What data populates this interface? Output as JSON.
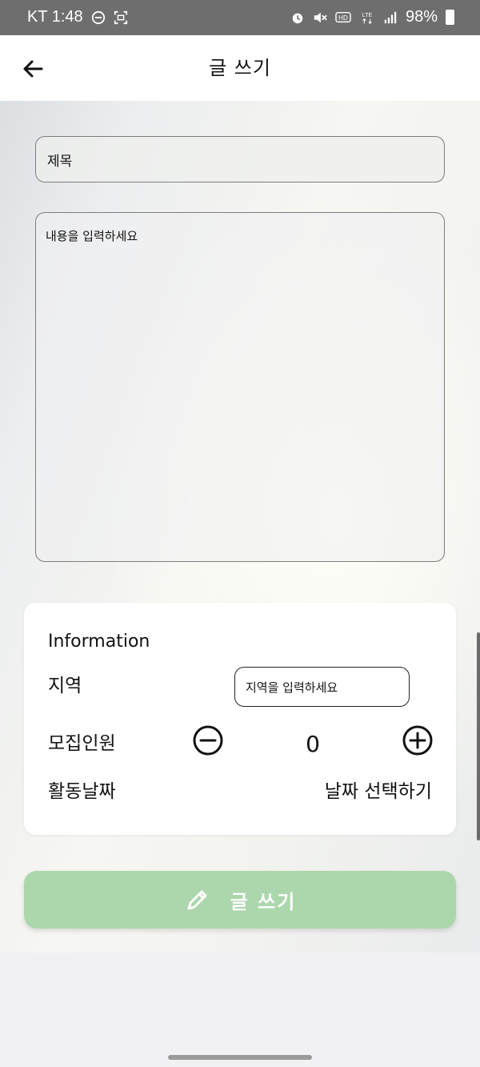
{
  "status_bar": {
    "carrier_time": "KT 1:48",
    "network": "LTE",
    "battery": "98%",
    "left_icons": [
      "minus-circle-icon",
      "screen-record-icon"
    ],
    "right_icons": [
      "alarm-icon",
      "mute-icon",
      "hd-icon",
      "lte-icon",
      "signal-icon",
      "battery-icon"
    ]
  },
  "app_bar": {
    "title": "글 쓰기",
    "back_icon": "arrow-left-icon"
  },
  "form": {
    "title_placeholder": "제목",
    "content_placeholder": "내용을 입력하세요"
  },
  "info": {
    "heading": "Information",
    "region_label": "지역",
    "region_placeholder": "지역을 입력하세요",
    "recruit_label": "모집인원",
    "recruit_count": "0",
    "date_label": "활동날짜",
    "date_action": "날짜 선택하기"
  },
  "submit": {
    "label": "글 쓰기",
    "icon": "pencil-icon",
    "color": "#acd6ab"
  }
}
